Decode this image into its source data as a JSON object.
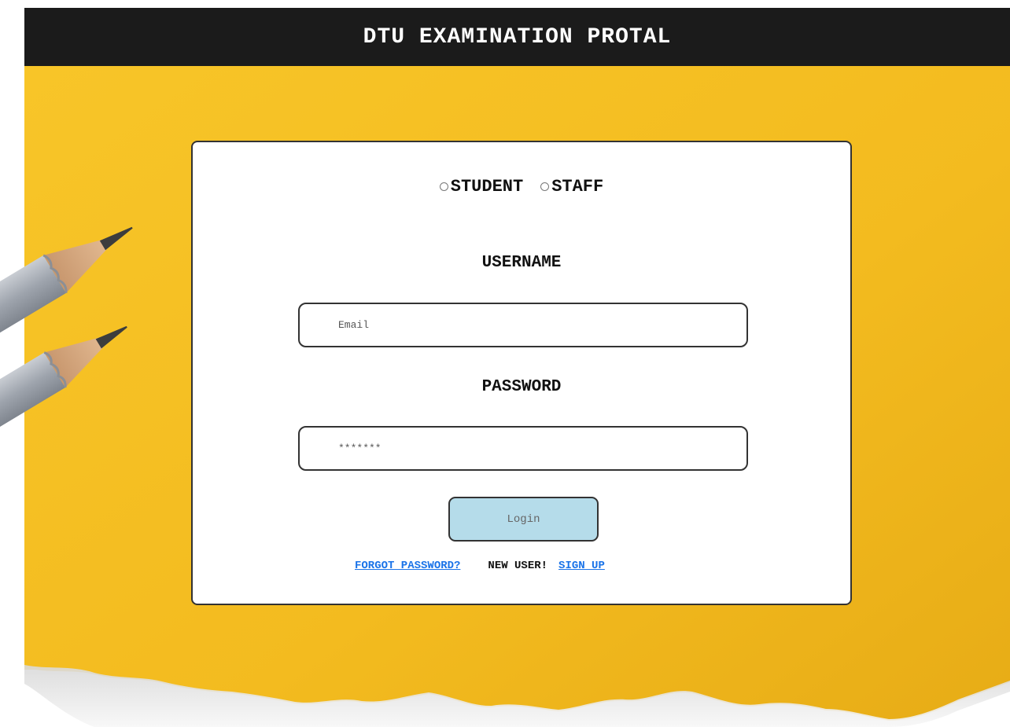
{
  "header": {
    "title": "DTU EXAMINATION PROTAL"
  },
  "login_form": {
    "roles": [
      {
        "label": "STUDENT",
        "selected": false
      },
      {
        "label": "STAFF",
        "selected": false
      }
    ],
    "username_label": "USERNAME",
    "email_placeholder": "Email",
    "email_value": "",
    "password_label": "PASSWORD",
    "password_placeholder": "*******",
    "password_value": "",
    "login_button": "Login",
    "forgot_password": "FORGOT PASSWORD?",
    "new_user_text": "NEW USER!",
    "sign_up": "SIGN UP"
  },
  "colors": {
    "header_bg": "#1b1b1b",
    "background_yellow": "#f2b91d",
    "login_button_bg": "#b5dcea",
    "link": "#1a73e8"
  },
  "icons": {
    "background": "pencils-illustration"
  }
}
